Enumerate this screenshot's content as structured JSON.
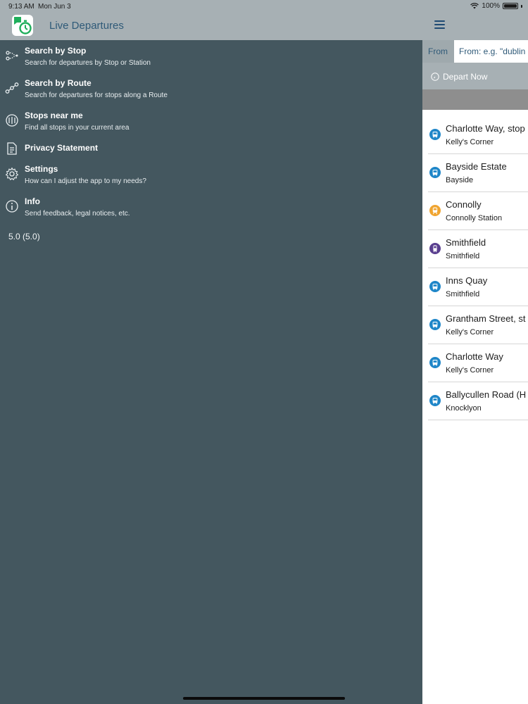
{
  "status_bar": {
    "time": "9:13 AM",
    "date": "Mon Jun 3",
    "battery": "100%"
  },
  "app": {
    "title": "Live Departures"
  },
  "menu": {
    "items": [
      {
        "title": "Search by Stop",
        "subtitle": "Search for departures by Stop or Station",
        "icon": "route-points-icon"
      },
      {
        "title": "Search by Route",
        "subtitle": "Search for departures for stops along a Route",
        "icon": "route-chain-icon"
      },
      {
        "title": "Stops near me",
        "subtitle": "Find all stops in your current area",
        "icon": "nearby-stops-icon"
      },
      {
        "title": "Privacy Statement",
        "subtitle": "",
        "icon": "document-icon"
      },
      {
        "title": "Settings",
        "subtitle": "How can I adjust the app to my needs?",
        "icon": "gear-icon"
      },
      {
        "title": "Info",
        "subtitle": "Send feedback, legal notices, etc.",
        "icon": "info-icon"
      }
    ],
    "version": "5.0 (5.0)"
  },
  "right_panel": {
    "from_label": "From",
    "from_placeholder": "From: e.g. \"dublin",
    "depart_label": "Depart Now",
    "stops": [
      {
        "name": "Charlotte Way, stop",
        "area": "Kelly's Corner",
        "mode": "bus"
      },
      {
        "name": "Bayside Estate",
        "area": "Bayside",
        "mode": "bus"
      },
      {
        "name": "Connolly",
        "area": "Connolly Station",
        "mode": "rail"
      },
      {
        "name": "Smithfield",
        "area": "Smithfield",
        "mode": "tram"
      },
      {
        "name": "Inns Quay",
        "area": "Smithfield",
        "mode": "bus"
      },
      {
        "name": "Grantham Street, st",
        "area": "Kelly's Corner",
        "mode": "bus"
      },
      {
        "name": "Charlotte Way",
        "area": "Kelly's Corner",
        "mode": "bus"
      },
      {
        "name": "Ballycullen Road (H",
        "area": "Knocklyon",
        "mode": "bus"
      }
    ]
  },
  "colors": {
    "drawer_bg": "#44575f",
    "header_bg": "#a7b0b4",
    "accent": "#2f5a78",
    "bus": "#1f86c8",
    "rail": "#f0a531",
    "tram": "#5a3f8f"
  }
}
